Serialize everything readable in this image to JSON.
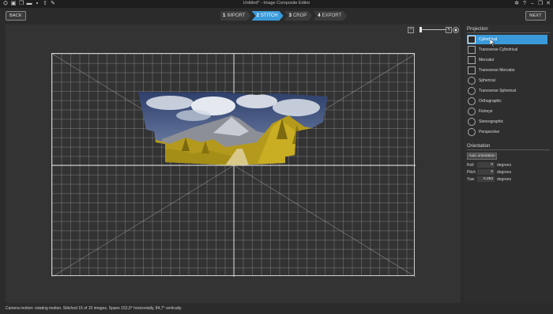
{
  "app": {
    "title": "Untitled* - Image Composite Editor"
  },
  "toolbar": {
    "back_label": "BACK",
    "next_label": "NEXT",
    "steps": [
      {
        "num": "1",
        "label": "IMPORT",
        "active": false
      },
      {
        "num": "2",
        "label": "STITCH",
        "active": true
      },
      {
        "num": "3",
        "label": "CROP",
        "active": false
      },
      {
        "num": "4",
        "label": "EXPORT",
        "active": false
      }
    ]
  },
  "zoom": {
    "minus": "−",
    "plus": "+",
    "fit_icon": "fit-icon",
    "level": 0.1
  },
  "panel": {
    "projection_title": "Projection",
    "projections": [
      {
        "label": "Cylindrical",
        "icon": "cylindrical-icon",
        "selected": true
      },
      {
        "label": "Transverse Cylindrical",
        "icon": "transverse-cylindrical-icon",
        "selected": false
      },
      {
        "label": "Mercator",
        "icon": "mercator-icon",
        "selected": false
      },
      {
        "label": "Transverse Mercator",
        "icon": "transverse-mercator-icon",
        "selected": false
      },
      {
        "label": "Spherical",
        "icon": "spherical-icon",
        "selected": false
      },
      {
        "label": "Transverse Spherical",
        "icon": "transverse-spherical-icon",
        "selected": false
      },
      {
        "label": "Orthographic",
        "icon": "orthographic-icon",
        "selected": false
      },
      {
        "label": "Fisheye",
        "icon": "fisheye-icon",
        "selected": false
      },
      {
        "label": "Stereographic",
        "icon": "stereographic-icon",
        "selected": false
      },
      {
        "label": "Perspective",
        "icon": "perspective-icon",
        "selected": false
      }
    ],
    "orientation_title": "Orientation",
    "auto_orientation_label": "Auto orientation",
    "orientation": [
      {
        "label": "Roll",
        "value": "0",
        "unit": "degrees"
      },
      {
        "label": "Pitch",
        "value": "0",
        "unit": "degrees"
      },
      {
        "label": "Yaw",
        "value": "0.283",
        "unit": "degrees"
      }
    ]
  },
  "status": {
    "text": "Camera motion: rotating motion. Stitched 15 of 15 images. Spans 152,9° horizontally, 84,7° vertically."
  },
  "colors": {
    "accent": "#3a9ad9",
    "background": "#2b2b2b",
    "canvas": "#333333"
  }
}
